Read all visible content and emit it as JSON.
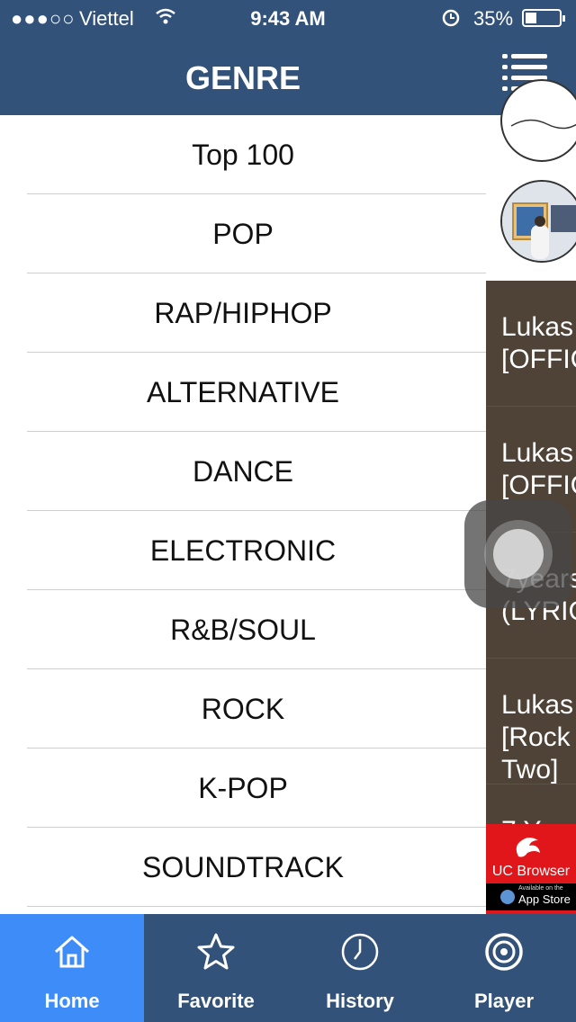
{
  "status_bar": {
    "signal": "●●●○○",
    "carrier": "Viettel",
    "time": "9:43 AM",
    "battery": "35%"
  },
  "header": {
    "title": "GENRE"
  },
  "genres": [
    "Top 100",
    "POP",
    "RAP/HIPHOP",
    "ALTERNATIVE",
    "DANCE",
    "ELECTRONIC",
    "R&B/SOUL",
    "ROCK",
    "K-POP",
    "SOUNDTRACK"
  ],
  "side_panel": {
    "tracks": [
      "Lukas\n[OFFIC",
      "Lukas\n[OFFIC",
      "7years\n(LYRIC",
      "Lukas\n[Rock\nTwo]",
      "7 Y"
    ]
  },
  "ad": {
    "brand": "UC Browser",
    "store_small": "Available on the",
    "store": "App Store",
    "color": "#e1161a"
  },
  "tabs": [
    {
      "label": "Home",
      "icon": "home-icon",
      "active": true
    },
    {
      "label": "Favorite",
      "icon": "star-icon",
      "active": false
    },
    {
      "label": "History",
      "icon": "clock-icon",
      "active": false
    },
    {
      "label": "Player",
      "icon": "disc-icon",
      "active": false
    }
  ],
  "colors": {
    "header": "#32527a",
    "active_tab": "#3d8cf8",
    "panel": "#4f4338"
  }
}
